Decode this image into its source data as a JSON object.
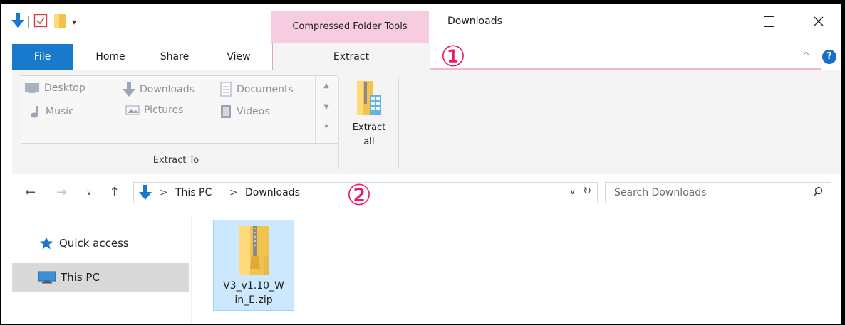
{
  "window": {
    "title": "Downloads",
    "context_tab": "Compressed Folder Tools"
  },
  "quick_access_toolbar": {
    "icons": [
      "download-arrow-icon",
      "properties-check-icon",
      "new-folder-icon",
      "customize-dropdown-icon"
    ]
  },
  "window_controls": {
    "minimize": "—",
    "maximize": "☐",
    "close": "✕"
  },
  "ribbon": {
    "tabs": [
      {
        "label": "File"
      },
      {
        "label": "Home"
      },
      {
        "label": "Share"
      },
      {
        "label": "View"
      },
      {
        "label": "Extract"
      }
    ],
    "collapse_glyph": "^",
    "help_glyph": "?",
    "extract_to": {
      "items": [
        {
          "label": "Desktop",
          "icon": "desktop-icon"
        },
        {
          "label": "Downloads",
          "icon": "downloads-icon"
        },
        {
          "label": "Documents",
          "icon": "documents-icon"
        },
        {
          "label": "Music",
          "icon": "music-icon"
        },
        {
          "label": "Pictures",
          "icon": "pictures-icon"
        },
        {
          "label": "Videos",
          "icon": "videos-icon"
        }
      ],
      "group_label": "Extract To"
    },
    "extract_all": {
      "line1": "Extract",
      "line2": "all"
    }
  },
  "address_bar": {
    "breadcrumbs": [
      "This PC",
      "Downloads"
    ],
    "separator": ">",
    "search_placeholder": "Search Downloads"
  },
  "annotations": {
    "one": "①",
    "two": "②",
    "color": "#e8196b"
  },
  "nav_pane": {
    "items": [
      {
        "label": "Quick access",
        "icon": "star-icon",
        "selected": false
      },
      {
        "label": "This PC",
        "icon": "monitor-icon",
        "selected": true
      }
    ]
  },
  "files": [
    {
      "name_line1": "V3_v1.10_W",
      "name_line2": "in_E.zip",
      "icon": "zip-folder-icon",
      "selected": true
    }
  ],
  "colors": {
    "file_tab": "#1979ca",
    "context_tab": "#f8cce0",
    "selection": "#cce8ff"
  }
}
